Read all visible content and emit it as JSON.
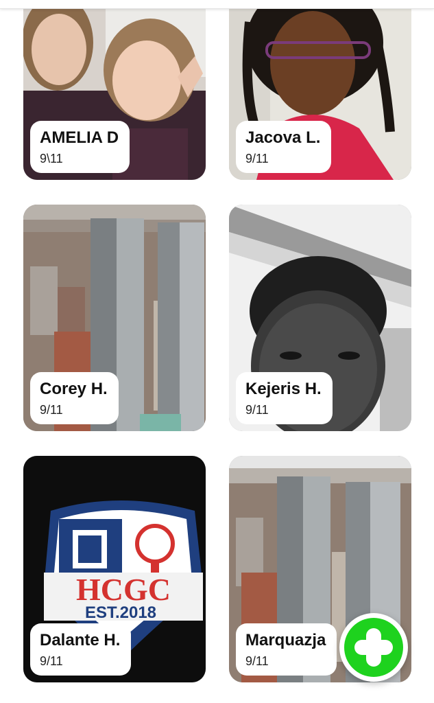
{
  "cards": [
    {
      "name": "AMELIA D",
      "date": "9\\11",
      "photo": "selfie-two-girls"
    },
    {
      "name": "Jacova L.",
      "date": "9/11",
      "photo": "selfie-girl-glasses"
    },
    {
      "name": "Corey H.",
      "date": "9/11",
      "photo": "twin-towers"
    },
    {
      "name": "Kejeris H.",
      "date": "9/11",
      "photo": "selfie-boy-bw"
    },
    {
      "name": "Dalante H.",
      "date": "9/11",
      "photo": "hcgc-patch"
    },
    {
      "name": "Marquazja",
      "date": "9/11",
      "photo": "twin-towers"
    }
  ],
  "patch": {
    "text": "HCGC",
    "est": "EST.2018"
  },
  "fab": {
    "icon": "plus-icon",
    "color": "#1ed21e"
  }
}
